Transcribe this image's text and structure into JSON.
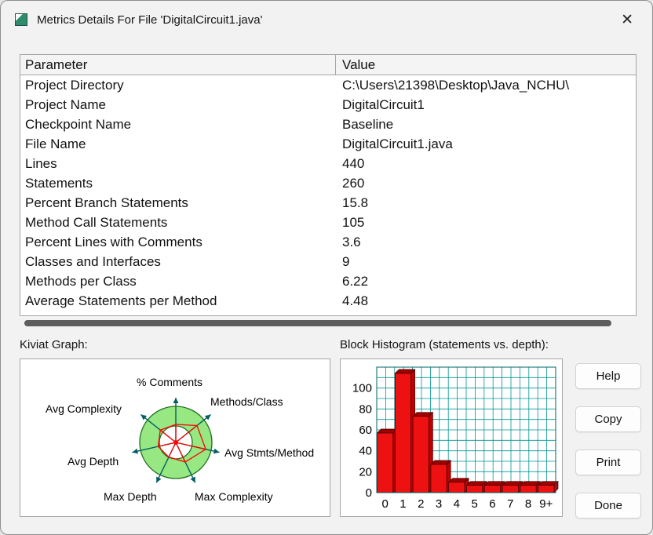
{
  "window": {
    "title": "Metrics Details For File 'DigitalCircuit1.java'",
    "close_glyph": "✕"
  },
  "table": {
    "columns": [
      "Parameter",
      "Value"
    ],
    "rows": [
      {
        "parameter": "Project Directory",
        "value": "C:\\Users\\21398\\Desktop\\Java_NCHU\\"
      },
      {
        "parameter": "Project Name",
        "value": "DigitalCircuit1"
      },
      {
        "parameter": "Checkpoint Name",
        "value": "Baseline"
      },
      {
        "parameter": "File Name",
        "value": "DigitalCircuit1.java"
      },
      {
        "parameter": "Lines",
        "value": "440"
      },
      {
        "parameter": "Statements",
        "value": "260"
      },
      {
        "parameter": "Percent Branch Statements",
        "value": "15.8"
      },
      {
        "parameter": "Method Call Statements",
        "value": "105"
      },
      {
        "parameter": "Percent Lines with Comments",
        "value": "3.6"
      },
      {
        "parameter": "Classes and Interfaces",
        "value": "9"
      },
      {
        "parameter": "Methods per Class",
        "value": "6.22"
      },
      {
        "parameter": "Average Statements per Method",
        "value": "4.48"
      }
    ]
  },
  "sections": {
    "kiviat_label": "Kiviat Graph:",
    "histogram_label": "Block Histogram (statements vs. depth):"
  },
  "kiviat": {
    "labels": [
      "% Comments",
      "Methods/Class",
      "Avg Stmts/Method",
      "Max Complexity",
      "Max Depth",
      "Avg Depth",
      "Avg Complexity"
    ],
    "values": [
      0.5,
      0.75,
      0.85,
      0.6,
      0.45,
      0.5,
      0.55
    ],
    "colors": {
      "ring": "#97e783",
      "ring_edge": "#1d6e1d",
      "spoke": "#015f5f",
      "data": "#ff0000"
    }
  },
  "chart_data": {
    "type": "bar",
    "title": "Block Histogram (statements vs. depth)",
    "categories": [
      "0",
      "1",
      "2",
      "3",
      "4",
      "5",
      "6",
      "7",
      "8",
      "9+"
    ],
    "values": [
      57,
      114,
      73,
      27,
      10,
      7,
      7,
      7,
      7,
      7
    ],
    "xlabel": "depth",
    "ylabel": "statements",
    "ylim": [
      0,
      120
    ],
    "yticks": [
      0,
      20,
      40,
      60,
      80,
      100
    ],
    "grid": true,
    "grid_color": "#009595",
    "bar_color": "#ee1111"
  },
  "buttons": [
    {
      "label": "Help"
    },
    {
      "label": "Copy"
    },
    {
      "label": "Print"
    },
    {
      "label": "Done"
    }
  ]
}
